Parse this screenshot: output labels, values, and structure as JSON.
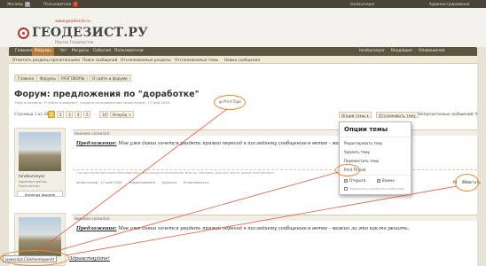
{
  "topbar": {
    "complaints": "Жалобы",
    "complaints_count": "0",
    "users": "Пользователи",
    "users_count": "2",
    "user": "landsurveyor",
    "admin": "Администрирование"
  },
  "logo": {
    "url": "www.geodesist.ru",
    "name": "ГЕОДЕЗИСТ.РУ",
    "tagline": "Портал Геодезистов"
  },
  "nav": {
    "items": [
      "Главная",
      "Форумы",
      "Чат",
      "Ресурсы",
      "События",
      "Пользователи"
    ],
    "active": 1,
    "right_user": "landsurveyor",
    "right_inbox": "Входящие",
    "right_alerts": "Оповещения"
  },
  "subnav": {
    "items": [
      "Отметить разделы прочитанными",
      "Поиск сообщений",
      "Отслеживаемые разделы",
      "Отслеживаемые темы",
      "Новые сообщения"
    ]
  },
  "breadcrumb": [
    "Главная",
    "Форумы",
    "РАЗГОВОРЫ",
    "О сайте и форуме"
  ],
  "page": {
    "title": "Форум: предложения по \"доработке\"",
    "subtitle": "Тема в разделе \"О сайте и форуме\", создана пользователем landsurveyor, 17 май 2009.",
    "print_link": "Print Topic"
  },
  "pager": {
    "label": "Страница 1 из 34",
    "pages": [
      "1",
      "2",
      "3",
      "4",
      "5"
    ],
    "last": "34",
    "next": "Вперёд >",
    "thread_options": "Опции темы",
    "watch": "Отслеживать тему",
    "unread": "Непрочитанных сообщений: 0"
  },
  "post1": {
    "header": "Никомех сказал(а):",
    "lead": "Предложение:",
    "body": "Мне уже давно хочется увидеть прямой переход к последнему сообщению в ветке - можно его это решить.",
    "signature": "Где ваш действительно бессмертием, безгрешно в погашении! Всегда, Никомех. Быстро, легко, доход всё.Никомех. ",
    "author_date": "landsurveyor, 17 май 2009",
    "edit": "Редактировать",
    "delete": "Удалить",
    "report": "Пожаловаться",
    "number": "#1",
    "reply": "Ответить",
    "print": "Print"
  },
  "author": {
    "name": "landsurveyor",
    "role": "Администратор, Константин",
    "team": "Команда форума"
  },
  "popup": {
    "title": "Опции темы",
    "items": [
      "Редактировать тему",
      "Удалить тему",
      "Переместить тему",
      "Print Thread"
    ],
    "check_open": "Открыта",
    "check_pinned": "Важно",
    "notice": "Модерация удалённые сообщения"
  },
  "post2": {
    "header": "Никомех сказал(а):",
    "lead": "Предложение:",
    "body": "Мне уже давно хочется увидеть прямой переход к последнему сообщению в ветке - можно ли это как-то решить."
  },
  "bottom": {
    "js_tooltip": "javascript:Clickhere(openit)",
    "greeting": "Здравствуйте!"
  },
  "colors": {
    "highlight": "#e8892c",
    "nav_bg": "#5e553f",
    "active_tab": "#b87a3c"
  }
}
